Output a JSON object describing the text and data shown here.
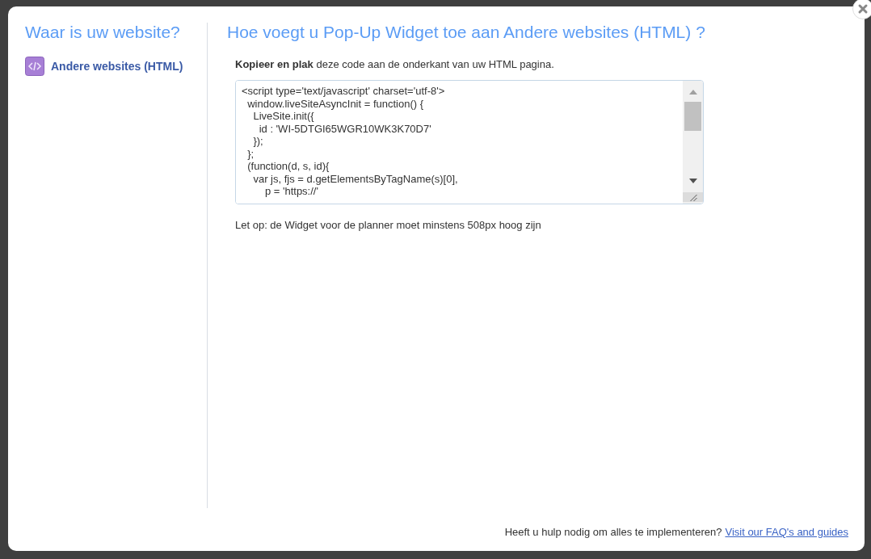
{
  "sidebar": {
    "title": "Waar is uw website?",
    "items": [
      {
        "label": "Andere websites (HTML)",
        "selected": true
      }
    ]
  },
  "main": {
    "title": "Hoe voegt u Pop-Up Widget toe aan Andere websites (HTML) ?",
    "instruction": "**Kopieer en plak** deze code aan de onderkant van uw HTML pagina.",
    "code_lines": [
      "<script type='text/javascript' charset='utf-8'>",
      "  window.liveSiteAsyncInit = function() {",
      "    LiveSite.init({",
      "      id : 'WI-5DTGI65WGR10WK3K70D7'",
      "    });",
      "  };",
      "  (function(d, s, id){",
      "    var js, fjs = d.getElementsByTagName(s)[0],",
      "        p = 'https://'"
    ],
    "note": "Let op: de Widget voor de planner moet minstens 508px hoog zijn"
  },
  "footer": {
    "text": "Heeft u hulp nodig om alles te implementeren?",
    "link": "Visit our FAQ's and guides"
  }
}
